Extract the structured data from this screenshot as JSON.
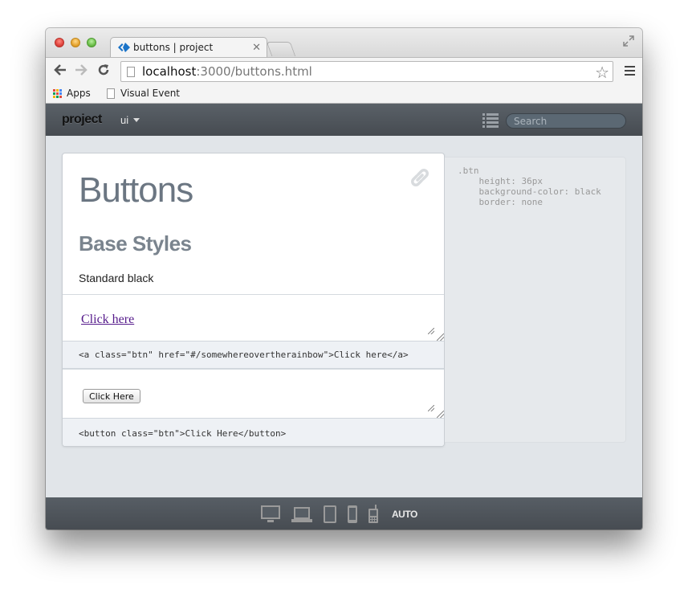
{
  "browser": {
    "tab_title": "buttons | project",
    "url_host": "localhost",
    "url_rest": ":3000/buttons.html",
    "bookmarks": [
      {
        "label": "Apps",
        "icon": "apps-grid-icon"
      },
      {
        "label": "Visual Event",
        "icon": "document-icon"
      }
    ]
  },
  "appbar": {
    "brand": "project",
    "menu_label": "ui",
    "search_placeholder": "Search"
  },
  "card": {
    "title": "Buttons",
    "section_title": "Base Styles",
    "description": "Standard black",
    "examples": [
      {
        "demo_label": "Click here",
        "code": "<a class=\"btn\" href=\"#/somewhereovertherainbow\">Click here</a>"
      },
      {
        "demo_label": "Click Here",
        "code": "<button class=\"btn\">Click Here</button>"
      }
    ]
  },
  "css_panel": {
    "code": ".btn\n    height: 36px\n    background-color: black\n    border: none"
  },
  "footer": {
    "devices": [
      "desktop",
      "laptop",
      "tablet",
      "phone",
      "feature-phone"
    ],
    "auto_label": "AUTO"
  },
  "colors": {
    "appbar": "#4f555b",
    "content_bg": "#e1e5e9",
    "heading": "#6b7682",
    "link_visited": "#551a8b",
    "code_bg": "#eef1f5"
  }
}
